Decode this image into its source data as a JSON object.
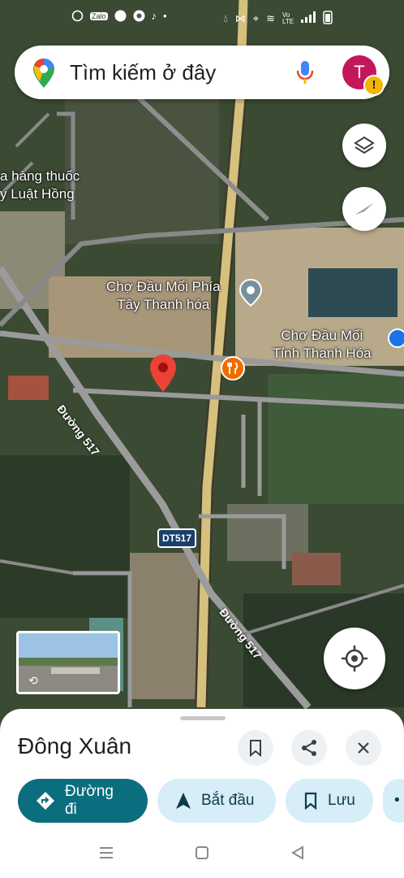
{
  "status_bar": {
    "icons": [
      "messenger-icon",
      "zalo-icon",
      "facebook-icon",
      "chrome-icon",
      "tiktok-icon",
      "dot-icon",
      "water-drop-icon",
      "vibrate-icon",
      "location-icon",
      "wifi-icon",
      "volte-icon",
      "signal-icon",
      "battery-icon"
    ],
    "volte_label": "Vo LTE"
  },
  "search": {
    "placeholder": "Tìm kiếm ở đây",
    "avatar_initial": "T",
    "warning": "!"
  },
  "map": {
    "labels": {
      "pharmacy_line1": "a hàng thuốc",
      "pharmacy_line2": "y Luật Hồng",
      "market1_line1": "Chợ Đầu Mối Phía",
      "market1_line2": "Tây Thanh hóa",
      "market2_line1": "Chợ Đầu Mối",
      "market2_line2": "Tỉnh Thanh Hóa",
      "road1": "Đường 517",
      "road2": "Đường 517",
      "shield": "DT517"
    }
  },
  "sheet": {
    "place_name": "Đông Xuân",
    "actions": [
      {
        "label": "Đường đi"
      },
      {
        "label": "Bắt đầu"
      },
      {
        "label": "Lưu"
      }
    ]
  },
  "colors": {
    "primary": "#0b6e7f",
    "pill_light": "#d7edf7",
    "pin_red": "#ea4335",
    "food_orange": "#ef6c00"
  }
}
